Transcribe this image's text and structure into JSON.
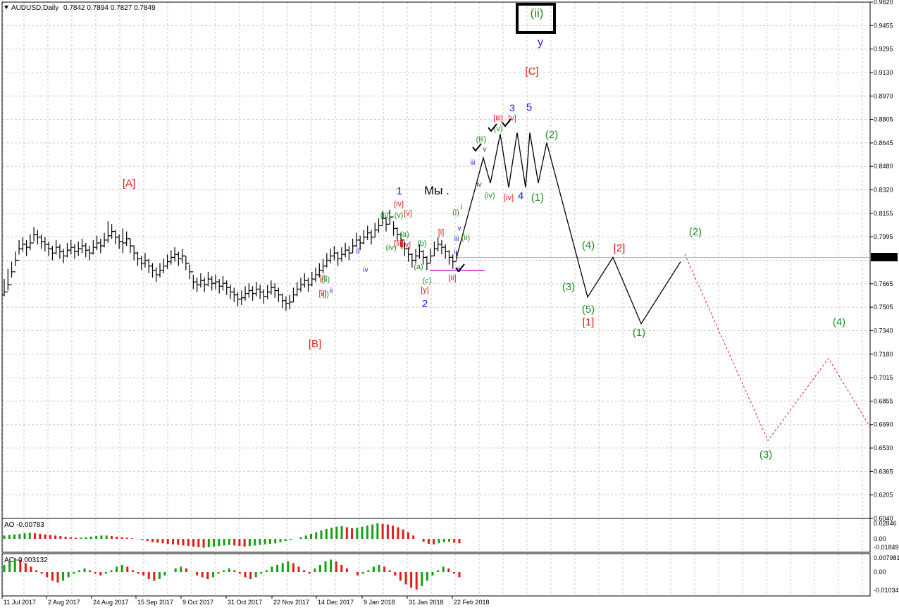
{
  "window": {
    "title": "AUDUSD,Daily",
    "ohlc": "0.7842 0.7894 0.7827 0.7849",
    "menu_icon": "triangle-down-icon"
  },
  "price_tag": "0.7849",
  "chart_data": {
    "type": "bar",
    "symbol": "AUDUSD",
    "timeframe": "Daily",
    "ylim": [
      0.604,
      0.962
    ],
    "y_ticks": [
      "0.9620",
      "0.9455",
      "0.9295",
      "0.9130",
      "0.8970",
      "0.8805",
      "0.8645",
      "0.8480",
      "0.8320",
      "0.8155",
      "0.7995",
      "0.7849",
      "0.7665",
      "0.7505",
      "0.7340",
      "0.7180",
      "0.7015",
      "0.6855",
      "0.6690",
      "0.6530",
      "0.6365",
      "0.6205",
      "0.6040"
    ],
    "x_ticks": [
      "11 Jul 2017",
      "2 Aug 2017",
      "24 Aug 2017",
      "15 Sep 2017",
      "9 Oct 2017",
      "31 Oct 2017",
      "22 Nov 2017",
      "14 Dec 2017",
      "9 Jan 2018",
      "31 Jan 2018",
      "22 Feb 2018"
    ],
    "grid": true,
    "price_line": 0.7849,
    "support_line": 0.776,
    "price_path": [
      [
        0.761,
        0.77,
        0.758
      ],
      [
        0.766,
        0.777,
        0.762
      ],
      [
        0.775,
        0.782,
        0.771
      ],
      [
        0.783,
        0.789,
        0.779
      ],
      [
        0.791,
        0.797,
        0.787
      ],
      [
        0.794,
        0.799,
        0.789
      ],
      [
        0.792,
        0.797,
        0.786
      ],
      [
        0.795,
        0.801,
        0.79
      ],
      [
        0.801,
        0.806,
        0.796
      ],
      [
        0.799,
        0.804,
        0.794
      ],
      [
        0.796,
        0.801,
        0.791
      ],
      [
        0.794,
        0.799,
        0.789
      ],
      [
        0.791,
        0.796,
        0.786
      ],
      [
        0.788,
        0.793,
        0.783
      ],
      [
        0.792,
        0.797,
        0.787
      ],
      [
        0.789,
        0.794,
        0.784
      ],
      [
        0.786,
        0.791,
        0.781
      ],
      [
        0.79,
        0.795,
        0.785
      ],
      [
        0.792,
        0.797,
        0.787
      ],
      [
        0.789,
        0.794,
        0.784
      ],
      [
        0.791,
        0.796,
        0.786
      ],
      [
        0.793,
        0.798,
        0.788
      ],
      [
        0.79,
        0.795,
        0.785
      ],
      [
        0.788,
        0.793,
        0.783
      ],
      [
        0.792,
        0.797,
        0.787
      ],
      [
        0.795,
        0.8,
        0.79
      ],
      [
        0.793,
        0.798,
        0.788
      ],
      [
        0.797,
        0.802,
        0.792
      ],
      [
        0.8,
        0.81,
        0.795
      ],
      [
        0.803,
        0.808,
        0.798
      ],
      [
        0.799,
        0.804,
        0.794
      ],
      [
        0.796,
        0.801,
        0.791
      ],
      [
        0.795,
        0.805,
        0.788
      ],
      [
        0.798,
        0.803,
        0.793
      ],
      [
        0.793,
        0.798,
        0.788
      ],
      [
        0.788,
        0.793,
        0.783
      ],
      [
        0.784,
        0.789,
        0.779
      ],
      [
        0.781,
        0.786,
        0.776
      ],
      [
        0.783,
        0.788,
        0.778
      ],
      [
        0.779,
        0.784,
        0.774
      ],
      [
        0.776,
        0.781,
        0.771
      ],
      [
        0.773,
        0.778,
        0.768
      ],
      [
        0.776,
        0.781,
        0.771
      ],
      [
        0.779,
        0.784,
        0.774
      ],
      [
        0.782,
        0.787,
        0.777
      ],
      [
        0.785,
        0.79,
        0.78
      ],
      [
        0.787,
        0.792,
        0.782
      ],
      [
        0.784,
        0.789,
        0.779
      ],
      [
        0.786,
        0.791,
        0.781
      ],
      [
        0.781,
        0.786,
        0.776
      ],
      [
        0.775,
        0.78,
        0.77
      ],
      [
        0.768,
        0.773,
        0.763
      ],
      [
        0.766,
        0.771,
        0.761
      ],
      [
        0.769,
        0.774,
        0.764
      ],
      [
        0.766,
        0.771,
        0.761
      ],
      [
        0.77,
        0.775,
        0.765
      ],
      [
        0.767,
        0.772,
        0.762
      ],
      [
        0.768,
        0.773,
        0.763
      ],
      [
        0.765,
        0.77,
        0.76
      ],
      [
        0.767,
        0.772,
        0.762
      ],
      [
        0.764,
        0.769,
        0.759
      ],
      [
        0.761,
        0.766,
        0.756
      ],
      [
        0.759,
        0.764,
        0.754
      ],
      [
        0.756,
        0.761,
        0.751
      ],
      [
        0.757,
        0.762,
        0.752
      ],
      [
        0.76,
        0.765,
        0.755
      ],
      [
        0.762,
        0.767,
        0.757
      ],
      [
        0.76,
        0.765,
        0.755
      ],
      [
        0.763,
        0.768,
        0.758
      ],
      [
        0.761,
        0.766,
        0.756
      ],
      [
        0.758,
        0.763,
        0.753
      ],
      [
        0.761,
        0.766,
        0.756
      ],
      [
        0.764,
        0.769,
        0.759
      ],
      [
        0.762,
        0.767,
        0.757
      ],
      [
        0.759,
        0.764,
        0.754
      ],
      [
        0.755,
        0.76,
        0.75
      ],
      [
        0.753,
        0.758,
        0.748
      ],
      [
        0.754,
        0.759,
        0.749
      ],
      [
        0.759,
        0.764,
        0.754
      ],
      [
        0.763,
        0.768,
        0.758
      ],
      [
        0.766,
        0.771,
        0.761
      ],
      [
        0.769,
        0.774,
        0.764
      ],
      [
        0.766,
        0.771,
        0.761
      ],
      [
        0.77,
        0.775,
        0.765
      ],
      [
        0.773,
        0.778,
        0.768
      ],
      [
        0.776,
        0.781,
        0.771
      ],
      [
        0.779,
        0.784,
        0.774
      ],
      [
        0.783,
        0.788,
        0.778
      ],
      [
        0.786,
        0.791,
        0.781
      ],
      [
        0.788,
        0.793,
        0.783
      ],
      [
        0.784,
        0.789,
        0.779
      ],
      [
        0.787,
        0.792,
        0.782
      ],
      [
        0.79,
        0.795,
        0.785
      ],
      [
        0.788,
        0.793,
        0.783
      ],
      [
        0.793,
        0.798,
        0.788
      ],
      [
        0.797,
        0.802,
        0.792
      ],
      [
        0.795,
        0.8,
        0.79
      ],
      [
        0.799,
        0.804,
        0.794
      ],
      [
        0.802,
        0.807,
        0.797
      ],
      [
        0.799,
        0.804,
        0.794
      ],
      [
        0.804,
        0.809,
        0.799
      ],
      [
        0.807,
        0.812,
        0.802
      ],
      [
        0.812,
        0.817,
        0.807
      ],
      [
        0.808,
        0.813,
        0.803
      ],
      [
        0.813,
        0.818,
        0.808
      ],
      [
        0.805,
        0.81,
        0.8
      ],
      [
        0.801,
        0.806,
        0.796
      ],
      [
        0.797,
        0.802,
        0.792
      ],
      [
        0.791,
        0.796,
        0.786
      ],
      [
        0.787,
        0.792,
        0.782
      ],
      [
        0.783,
        0.788,
        0.778
      ],
      [
        0.786,
        0.791,
        0.781
      ],
      [
        0.789,
        0.794,
        0.784
      ],
      [
        0.785,
        0.79,
        0.78
      ],
      [
        0.781,
        0.786,
        0.776
      ],
      [
        0.786,
        0.791,
        0.781
      ],
      [
        0.791,
        0.796,
        0.786
      ],
      [
        0.794,
        0.799,
        0.789
      ],
      [
        0.792,
        0.797,
        0.787
      ],
      [
        0.789,
        0.794,
        0.784
      ],
      [
        0.785,
        0.79,
        0.78
      ],
      [
        0.782,
        0.787,
        0.777
      ],
      [
        0.7849,
        0.7894,
        0.7827
      ]
    ],
    "projection_path": [
      [
        0.7849,
        0
      ],
      [
        0.866,
        5
      ],
      [
        0.836,
        7
      ],
      [
        0.874,
        9
      ],
      [
        0.835,
        11
      ],
      [
        0.874,
        13
      ],
      [
        0.836,
        15
      ],
      [
        0.869,
        17
      ],
      [
        0.757,
        31
      ],
      [
        0.785,
        37
      ],
      [
        0.738,
        41
      ],
      [
        0.785,
        51
      ]
    ],
    "forecast_path": [
      [
        0.785,
        51
      ],
      [
        0.658,
        63
      ],
      [
        0.716,
        71
      ],
      [
        0.666,
        80
      ]
    ],
    "wave_labels": [
      {
        "text": "(ii)",
        "color": "#228B22"
      },
      {
        "text": "y",
        "color": "#1f1fdf"
      },
      {
        "text": "[C]",
        "color": "#e21b1b"
      },
      {
        "text": "3",
        "color": "#1f1fdf"
      },
      {
        "text": "5",
        "color": "#1f1fdf"
      },
      {
        "text": "[iii]",
        "color": "#e21b1b"
      },
      {
        "text": "[v]",
        "color": "#e21b1b"
      },
      {
        "text": "(v)",
        "color": "#228B22"
      },
      {
        "text": "(iii)",
        "color": "#228B22"
      },
      {
        "text": "v",
        "color": "#1f1fdf"
      },
      {
        "text": "(2)",
        "color": "#228B22"
      },
      {
        "text": "iii",
        "color": "#1f1fdf"
      },
      {
        "text": "iv",
        "color": "#1f1fdf"
      },
      {
        "text": "(iv)",
        "color": "#228B22"
      },
      {
        "text": "[iv]",
        "color": "#e21b1b"
      },
      {
        "text": "4",
        "color": "#1f1fdf"
      },
      {
        "text": "(1)",
        "color": "#228B22"
      },
      {
        "text": "[A]",
        "color": "#e21b1b"
      },
      {
        "text": "1",
        "color": "#1f1fdf"
      },
      {
        "text": "Мы .",
        "color": "#000000"
      },
      {
        "text": "[iv]",
        "color": "#e21b1b"
      },
      {
        "text": "(iii)",
        "color": "#228B22"
      },
      {
        "text": "(v)",
        "color": "#228B22"
      },
      {
        "text": "[v]",
        "color": "#e21b1b"
      },
      {
        "text": "(a)",
        "color": "#228B22"
      },
      {
        "text": "(iv)",
        "color": "#228B22"
      },
      {
        "text": "[iii]",
        "color": "#e21b1b"
      },
      {
        "text": "[iv]",
        "color": "#e21b1b"
      },
      {
        "text": "(b)",
        "color": "#228B22"
      },
      {
        "text": "[i]",
        "color": "#e21b1b"
      },
      {
        "text": "i",
        "color": "#1f1fdf"
      },
      {
        "text": "(i)",
        "color": "#228B22"
      },
      {
        "text": "v",
        "color": "#1f1fdf"
      },
      {
        "text": "iii",
        "color": "#1f1fdf"
      },
      {
        "text": "(ii)",
        "color": "#228B22"
      },
      {
        "text": "iv",
        "color": "#1f1fdf"
      },
      {
        "text": "ii",
        "color": "#1f1fdf"
      },
      {
        "text": "(a)",
        "color": "#228B22"
      },
      {
        "text": "(c)",
        "color": "#228B22"
      },
      {
        "text": "[y]",
        "color": "#e21b1b"
      },
      {
        "text": "2",
        "color": "#1f1fdf"
      },
      {
        "text": "[ii]",
        "color": "#e21b1b"
      },
      {
        "text": "ii",
        "color": "#1f1fdf"
      },
      {
        "text": "iv",
        "color": "#1f1fdf"
      },
      {
        "text": "[i]",
        "color": "#e21b1b"
      },
      {
        "text": "(i)",
        "color": "#228B22"
      },
      {
        "text": "[ii]",
        "color": "#e21b1b"
      },
      {
        "text": "(ii)",
        "color": "#228B22"
      },
      {
        "text": "ii",
        "color": "#1f1fdf"
      },
      {
        "text": "[B]",
        "color": "#e21b1b"
      },
      {
        "text": "(4)",
        "color": "#228B22"
      },
      {
        "text": "[2]",
        "color": "#e21b1b"
      },
      {
        "text": "(3)",
        "color": "#228B22"
      },
      {
        "text": "(5)",
        "color": "#228B22"
      },
      {
        "text": "[1]",
        "color": "#e21b1b"
      },
      {
        "text": "(1)",
        "color": "#228B22"
      },
      {
        "text": "(2)",
        "color": "#228B22"
      },
      {
        "text": "(3)",
        "color": "#228B22"
      },
      {
        "text": "(4)",
        "color": "#228B22"
      }
    ],
    "ao": {
      "label": "AO -0.00783",
      "y_ticks": [
        "0.02846",
        "0.00",
        "-0.01849"
      ],
      "values": [
        0.006,
        0.007,
        0.008,
        0.009,
        0.01,
        0.011,
        0.01,
        0.009,
        0.008,
        0.007,
        0.006,
        0.005,
        0.004,
        0.003,
        0.002,
        0.002,
        0.003,
        0.004,
        0.005,
        0.006,
        0.006,
        0.005,
        0.004,
        0.003,
        0.002,
        0.001,
        0.0,
        -0.002,
        -0.004,
        -0.006,
        -0.007,
        -0.008,
        -0.009,
        -0.01,
        -0.011,
        -0.012,
        -0.013,
        -0.014,
        -0.015,
        -0.016,
        -0.015,
        -0.014,
        -0.013,
        -0.012,
        -0.011,
        -0.012,
        -0.013,
        -0.014,
        -0.013,
        -0.012,
        -0.011,
        -0.01,
        -0.009,
        -0.008,
        -0.006,
        -0.004,
        -0.002,
        0.0,
        0.003,
        0.006,
        0.009,
        0.012,
        0.015,
        0.018,
        0.02,
        0.022,
        0.023,
        0.021,
        0.019,
        0.02,
        0.022,
        0.024,
        0.026,
        0.028,
        0.027,
        0.026,
        0.024,
        0.021,
        0.017,
        0.012,
        0.006,
        0.0,
        -0.005,
        -0.009,
        -0.01,
        -0.008,
        -0.006,
        -0.005,
        -0.007,
        -0.008
      ]
    },
    "ac": {
      "label": "AC -0.003132",
      "y_ticks": [
        "0.007981",
        "0.00",
        "-0.01034"
      ],
      "values": [
        0.004,
        0.006,
        0.008,
        0.007,
        0.005,
        0.003,
        0.001,
        -0.001,
        -0.003,
        -0.005,
        -0.006,
        -0.005,
        -0.003,
        -0.001,
        0.001,
        0.002,
        0.001,
        -0.001,
        -0.002,
        -0.001,
        0.001,
        0.003,
        0.004,
        0.003,
        0.001,
        -0.001,
        -0.002,
        -0.004,
        -0.005,
        -0.004,
        -0.002,
        0.0,
        0.002,
        0.003,
        0.002,
        0.0,
        -0.002,
        -0.003,
        -0.004,
        -0.003,
        -0.001,
        0.001,
        0.002,
        0.001,
        -0.001,
        -0.003,
        -0.004,
        -0.003,
        -0.001,
        0.001,
        0.003,
        0.004,
        0.005,
        0.006,
        0.005,
        0.003,
        0.001,
        -0.001,
        0.002,
        0.004,
        0.006,
        0.007,
        0.006,
        0.004,
        0.002,
        0.0,
        -0.002,
        -0.001,
        0.001,
        0.003,
        0.004,
        0.003,
        0.001,
        -0.002,
        -0.005,
        -0.007,
        -0.009,
        -0.01,
        -0.008,
        -0.005,
        -0.002,
        0.001,
        0.003,
        0.002,
        -0.001,
        -0.003
      ]
    }
  }
}
